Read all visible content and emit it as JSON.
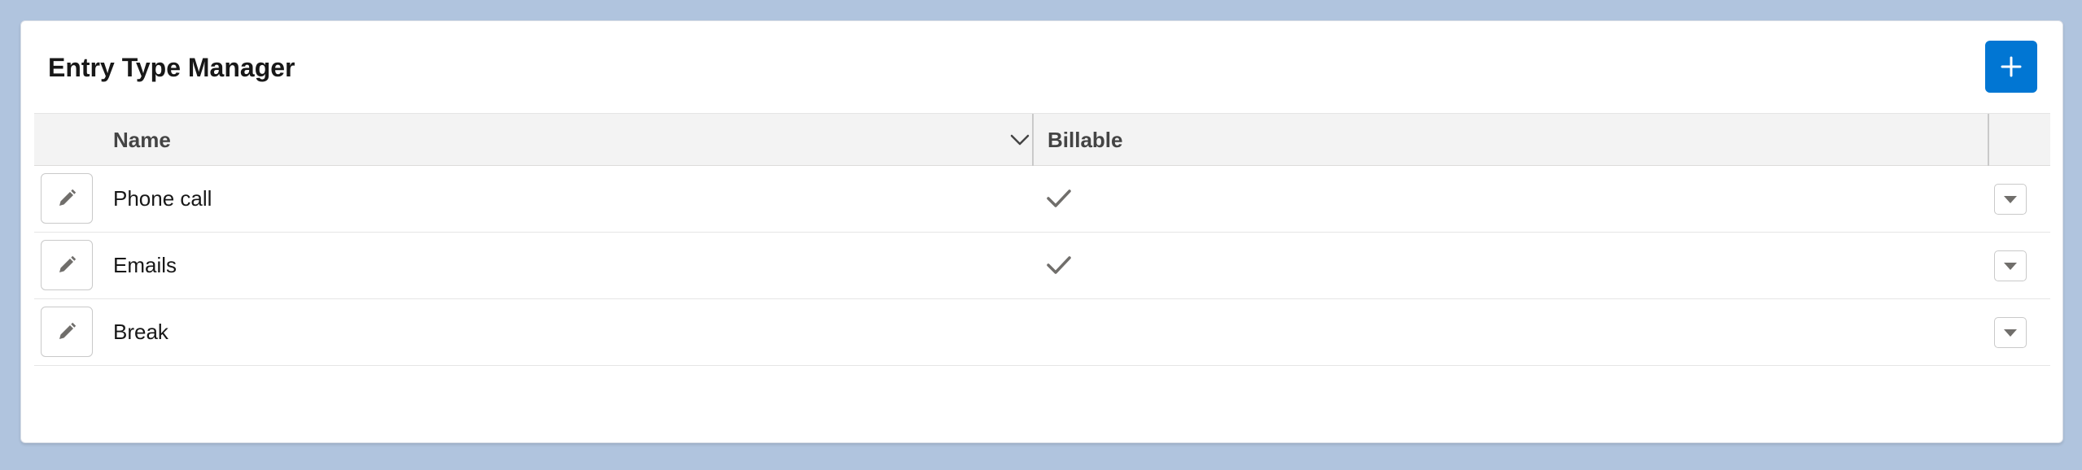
{
  "card": {
    "title": "Entry Type Manager",
    "add_icon": "plus-icon"
  },
  "table": {
    "columns": [
      {
        "label": "Name",
        "sort_icon": "chevron-down-icon"
      },
      {
        "label": "Billable"
      }
    ],
    "rows": [
      {
        "name": "Phone call",
        "billable": true
      },
      {
        "name": "Emails",
        "billable": true
      },
      {
        "name": "Break",
        "billable": false
      }
    ],
    "row_edit_icon": "pencil-icon",
    "row_check_icon": "check-icon",
    "row_action_icon": "caret-down-icon"
  },
  "colors": {
    "brand": "#0176d3",
    "background": "#b0c4de",
    "header_bg": "#f3f3f3",
    "border": "#c9c9c9",
    "icon": "#706e6b"
  }
}
